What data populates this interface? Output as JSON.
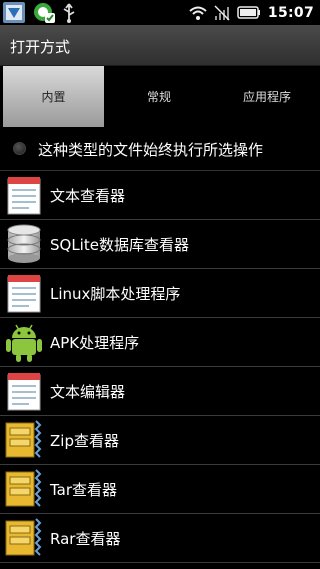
{
  "status_bar": {
    "time": "15:07",
    "left_icons": [
      "app-launcher-icon",
      "vpn-shield-icon",
      "usb-icon"
    ],
    "right_icons": [
      "wifi-icon",
      "no-signal-icon",
      "battery-icon"
    ]
  },
  "title_bar": {
    "title": "打开方式"
  },
  "tabs": [
    {
      "label": "内置",
      "active": true
    },
    {
      "label": "常规",
      "active": false
    },
    {
      "label": "应用程序",
      "active": false
    }
  ],
  "default_option": {
    "label": "这种类型的文件始终执行所选操作",
    "checked": false
  },
  "apps": [
    {
      "label": "文本查看器",
      "icon": "notepad-icon"
    },
    {
      "label": "SQLite数据库查看器",
      "icon": "database-icon"
    },
    {
      "label": "Linux脚本处理程序",
      "icon": "notepad-icon"
    },
    {
      "label": "APK处理程序",
      "icon": "android-icon"
    },
    {
      "label": "文本编辑器",
      "icon": "notepad-icon"
    },
    {
      "label": "Zip查看器",
      "icon": "archive-icon"
    },
    {
      "label": "Tar查看器",
      "icon": "archive-icon"
    },
    {
      "label": "Rar查看器",
      "icon": "archive-icon"
    }
  ],
  "colors": {
    "background": "#000000",
    "title_bar": "#3c3c3c",
    "active_tab": "#c4c4c4"
  }
}
